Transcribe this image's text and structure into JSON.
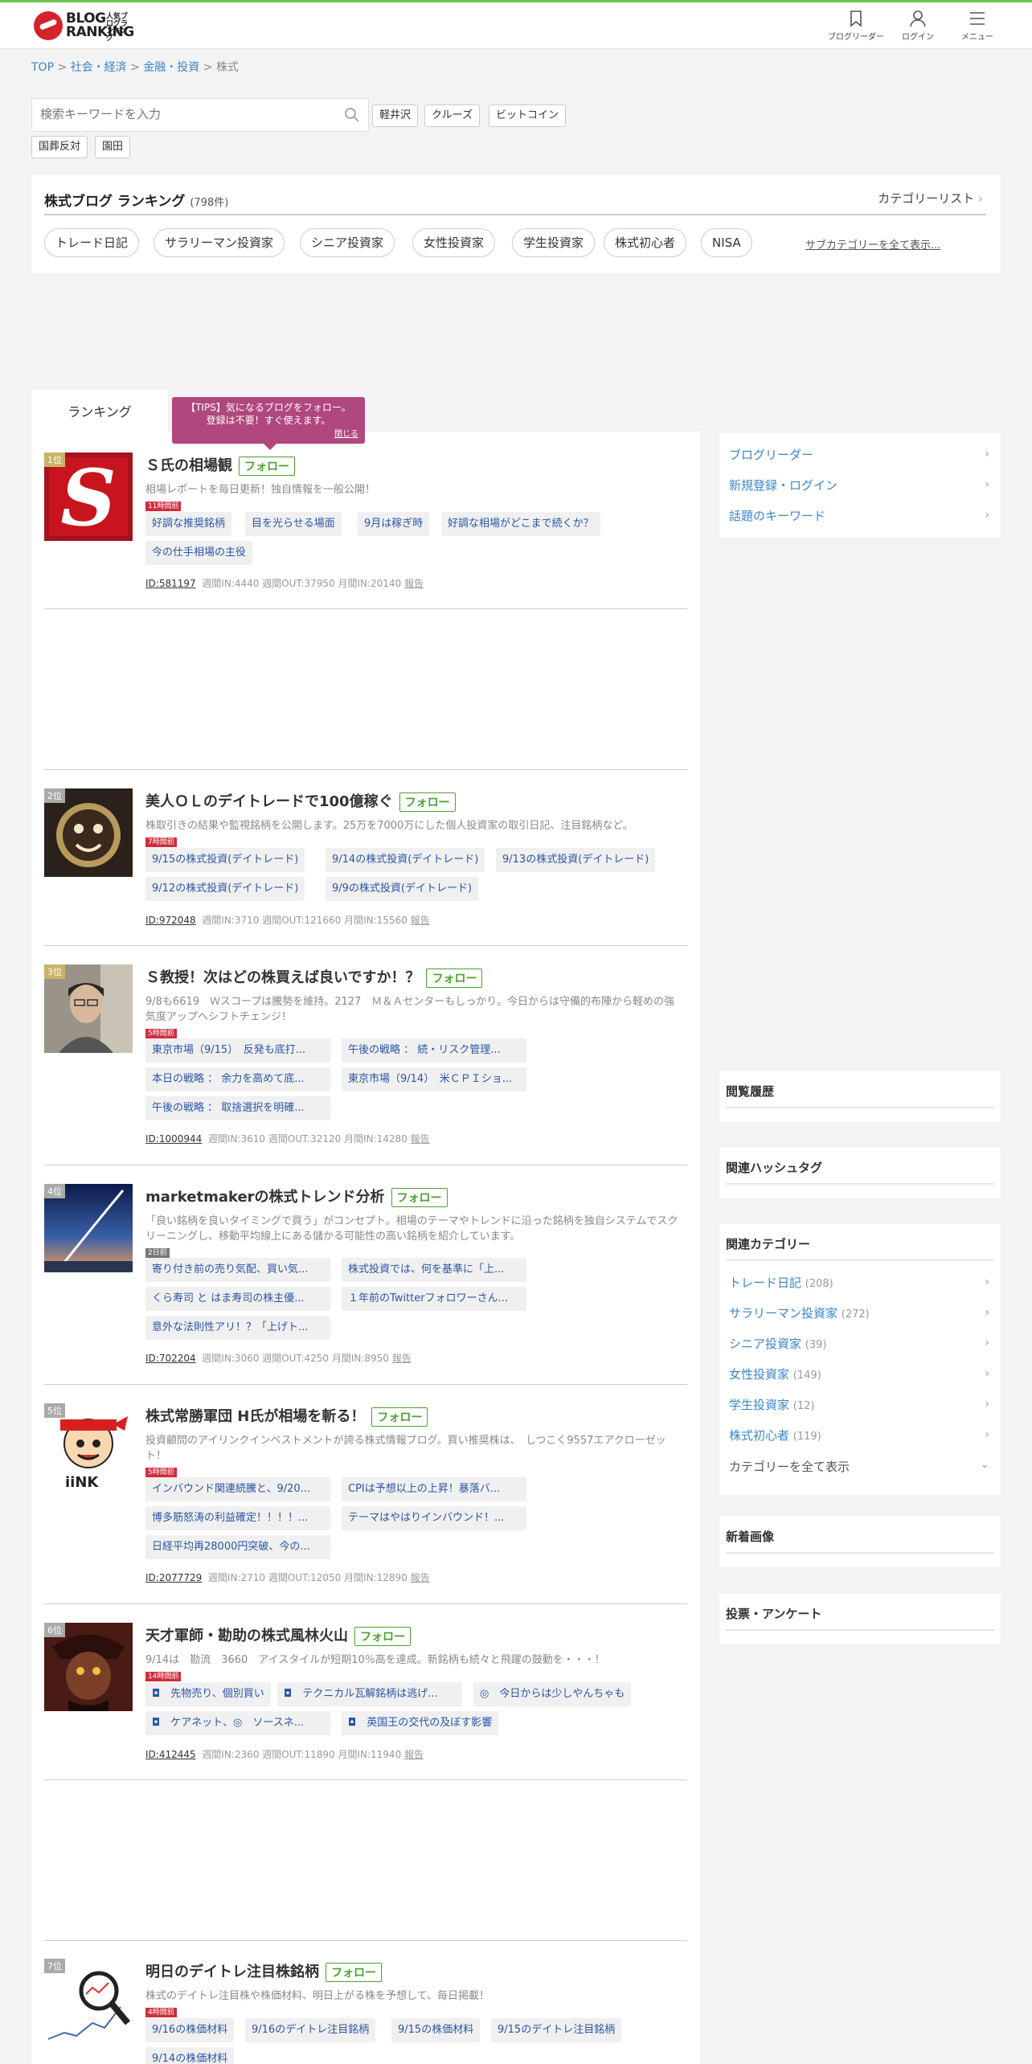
{
  "logo": {
    "line1": "BLOG",
    "line2": "RANKING",
    "small": "人気ブログランキング"
  },
  "header_nav": [
    {
      "label": "ブログリーダー",
      "icon": "bookmark-icon"
    },
    {
      "label": "ログイン",
      "icon": "user-icon"
    },
    {
      "label": "メニュー",
      "icon": "menu-icon"
    }
  ],
  "breadcrumb": {
    "items": [
      "TOP",
      "社会・経済",
      "金融・投資"
    ],
    "current": "株式",
    "sep": ">"
  },
  "search": {
    "placeholder": "検索キーワードを入力"
  },
  "keywords": [
    "軽井沢",
    "クルーズ",
    "ビットコイン",
    "国葬反対",
    "園田"
  ],
  "category": {
    "title": "株式ブログ ランキング",
    "count": "(798件)",
    "list_link": "カテゴリーリスト",
    "subcats": [
      "トレード日記",
      "サラリーマン投資家",
      "シニア投資家",
      "女性投資家",
      "学生投資家",
      "株式初心者",
      "NISA"
    ],
    "show_all": "サブカテゴリーを全て表示..."
  },
  "tab": {
    "label": "ランキング"
  },
  "tips": {
    "line1": "【TIPS】気になるブログをフォロー。",
    "line2": "登録は不要！すぐ使えます。",
    "close": "閉じる"
  },
  "follow_label": "フォロー",
  "entries": [
    {
      "rank": "1位",
      "title": "Ｓ氏の相場観",
      "desc": "相場レポートを毎日更新！独自情報を一般公開！",
      "badge": "11時間前",
      "tags": [
        "好調な推奨銘柄",
        "目を光らせる場面",
        "9月は稼ぎ時",
        "好調な相場がどこまで続くか？",
        "今の仕手相場の主役"
      ],
      "id": "ID:581197",
      "stats": "週間IN:4440 週間OUT:37950 月間IN:20140",
      "report": "報告"
    },
    {
      "rank": "2位",
      "title": "美人ＯＬのデイトレードで100億稼ぐ",
      "desc": "株取引きの結果や監視銘柄を公開します。25万を7000万にした個人投資家の取引日記、注目銘柄など。",
      "badge": "7時間前",
      "tags": [
        "9/15の株式投資(デイトレード)",
        "9/14の株式投資(デイトレード)",
        "9/13の株式投資(デイトレード)",
        "9/12の株式投資(デイトレード)",
        "9/9の株式投資(デイトレード)"
      ],
      "id": "ID:972048",
      "stats": "週間IN:3710 週間OUT:121660 月間IN:15560",
      "report": "報告"
    },
    {
      "rank": "3位",
      "title": "Ｓ教授！次はどの株買えば良いですか！？",
      "desc": "9/8も6619　Ｗスコープは騰勢を維持。2127　Ｍ＆Ａセンターもしっかり。今日からは守備的布陣から軽めの強気度アップへシフトチェンジ！",
      "badge": "5時間前",
      "tags": [
        "東京市場（9/15）　反発も底打...",
        "午後の戦略 ： 続・リスク管理...",
        "本日の戦略 ： 余力を高めて底...",
        "東京市場（9/14）　米ＣＰＩショ...",
        "午後の戦略 ： 取捨選択を明確..."
      ],
      "id": "ID:1000944",
      "stats": "週間IN:3610 週間OUT:32120 月間IN:14280",
      "report": "報告"
    },
    {
      "rank": "4位",
      "title": "marketmakerの株式トレンド分析",
      "desc": "「良い銘柄を良いタイミングで買う」がコンセプト。相場のテーマやトレンドに沿った銘柄を独自システムでスクリーニングし、移動平均線上にある儲かる可能性の高い銘柄を紹介しています。",
      "badge": "2日前",
      "tags": [
        "寄り付き前の売り気配、買い気...",
        "株式投資では、何を基準に「上...",
        "くら寿司 と はま寿司の株主優...",
        "１年前のTwitterフォロワーさん...",
        "意外な法則性アリ！？「上げト..."
      ],
      "id": "ID:702204",
      "stats": "週間IN:3060 週間OUT:4250 月間IN:8950",
      "report": "報告"
    },
    {
      "rank": "5位",
      "title": "株式常勝軍団 H氏が相場を斬る！",
      "desc": "投資顧問のアイリンクインベストメントが誇る株式情報ブログ。買い推奨株は、　しつこく9557エアクローゼット！",
      "badge": "5時間前",
      "tags": [
        "インバウンド関連続騰と、9/20...",
        "CPIは予想以上の上昇！暴落バ...",
        "博多筋怒涛の利益確定！！！！...",
        "テーマはやはりインバウンド！...",
        "日経平均再28000円突破、今の..."
      ],
      "id": "ID:2077729",
      "stats": "週間IN:2710 週間OUT:12050 月間IN:12890",
      "report": "報告"
    },
    {
      "rank": "6位",
      "title": "天才軍師・勘助の株式風林火山",
      "desc": "9/14は　勘流　3660　アイスタイルが短期10％高を達成。新銘柄も続々と飛躍の鼓動を・・・！",
      "badge": "14時間前",
      "tags": [
        "◘　先物売り、個別買い",
        "◘　テクニカル瓦解銘柄は逃げ...",
        "◎　今日からは少しやんちゃも",
        "◘　ケアネット、◎　ソースネ...",
        "◘　英国王の交代の及ぼす影響"
      ],
      "id": "ID:412445",
      "stats": "週間IN:2360 週間OUT:11890 月間IN:11940",
      "report": "報告"
    },
    {
      "rank": "7位",
      "title": "明日のデイトレ注目株銘柄",
      "desc": "株式のデイトレ注目株や株価材料、明日上がる株を予想して、毎日掲載！",
      "badge": "4時間前",
      "tags": [
        "9/16の株価材料",
        "9/16のデイトレ注目銘柄",
        "9/15の株価材料",
        "9/15のデイトレ注目銘柄",
        "9/14の株価材料"
      ]
    }
  ],
  "side_links": [
    "ブログリーダー",
    "新規登録・ログイン",
    "話題のキーワード"
  ],
  "side_sections": {
    "history": "閲覧履歴",
    "hashtag": "関連ハッシュタグ",
    "related": "関連カテゴリー",
    "new_images": "新着画像",
    "vote": "投票・アンケート"
  },
  "related_categories": [
    {
      "name": "トレード日記",
      "count": "(208)"
    },
    {
      "name": "サラリーマン投資家",
      "count": "(272)"
    },
    {
      "name": "シニア投資家",
      "count": "(39)"
    },
    {
      "name": "女性投資家",
      "count": "(149)"
    },
    {
      "name": "学生投資家",
      "count": "(12)"
    },
    {
      "name": "株式初心者",
      "count": "(119)"
    }
  ],
  "show_all_categories": "カテゴリーを全て表示"
}
